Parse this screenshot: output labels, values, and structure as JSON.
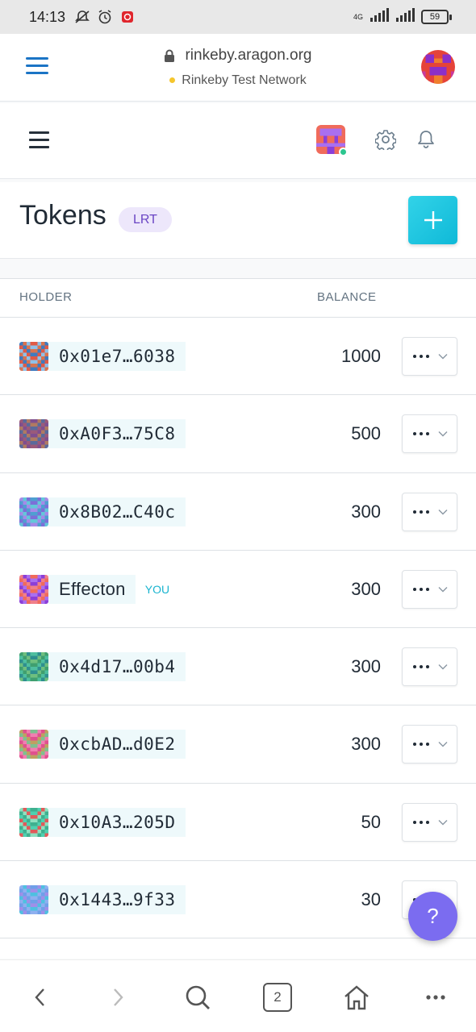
{
  "status_bar": {
    "time": "14:13",
    "network_type": "4G",
    "battery": "59"
  },
  "browser": {
    "url": "rinkeby.aragon.org",
    "network_label": "Rinkeby Test Network",
    "network_dot_color": "#f5c62d"
  },
  "app": {
    "title": "Tokens",
    "token_symbol": "LRT",
    "accent_color": "#1ec6e0",
    "online_color": "#2cc68f"
  },
  "table": {
    "columns": [
      "HOLDER",
      "BALANCE"
    ],
    "rows": [
      {
        "holder": "0x01e7…6038",
        "balance": "1000",
        "you": ""
      },
      {
        "holder": "0xA0F3…75C8",
        "balance": "500",
        "you": ""
      },
      {
        "holder": "0x8B02…C40c",
        "balance": "300",
        "you": ""
      },
      {
        "holder": "Effecton",
        "balance": "300",
        "you": "YOU"
      },
      {
        "holder": "0x4d17…00b4",
        "balance": "300",
        "you": ""
      },
      {
        "holder": "0xcbAD…d0E2",
        "balance": "300",
        "you": ""
      },
      {
        "holder": "0x10A3…205D",
        "balance": "50",
        "you": ""
      },
      {
        "holder": "0x1443…9f33",
        "balance": "30",
        "you": ""
      }
    ]
  },
  "help": {
    "label": "?"
  },
  "bottom_nav": {
    "tab_count": "2"
  }
}
